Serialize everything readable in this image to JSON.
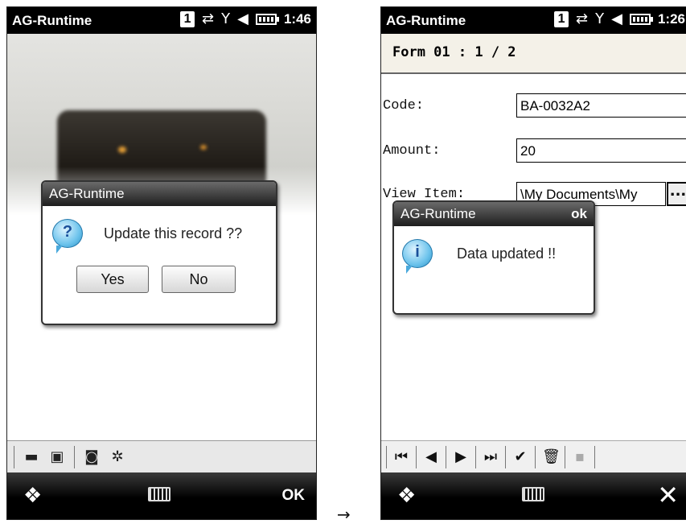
{
  "left_screen": {
    "status": {
      "app_title": "AG-Runtime",
      "badge": "1",
      "time": "1:46"
    },
    "dialog": {
      "title": "AG-Runtime",
      "message": "Update this record ??",
      "yes_label": "Yes",
      "no_label": "No",
      "icon": "question-icon"
    },
    "toolbar_icons": [
      "folder-icon",
      "save-icon",
      "camera-icon",
      "settings-icon"
    ],
    "softkeys": {
      "right": "OK"
    }
  },
  "right_screen": {
    "status": {
      "app_title": "AG-Runtime",
      "badge": "1",
      "time": "1:26"
    },
    "form_title": "Form 01 : 1 / 2",
    "fields": [
      {
        "label": "Code:",
        "value": "BA-0032A2"
      },
      {
        "label": "Amount:",
        "value": "20"
      },
      {
        "label": "View Item:",
        "value": "\\My Documents\\My"
      }
    ],
    "browse_label": "...",
    "dialog": {
      "title": "AG-Runtime",
      "ok_label": "ok",
      "message": "Data updated !!",
      "icon": "info-icon"
    },
    "toolbar_icons": [
      "first-record-icon",
      "previous-record-icon",
      "next-record-icon",
      "last-record-icon",
      "confirm-icon",
      "delete-icon",
      "disabled-icon"
    ]
  },
  "transition_arrow": "→"
}
